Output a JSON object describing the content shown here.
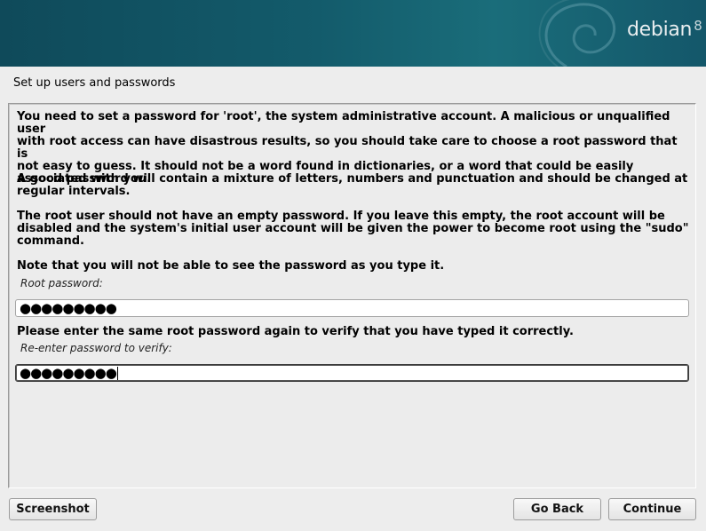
{
  "header": {
    "brand_name": "debian",
    "brand_version": "8"
  },
  "page": {
    "title": "Set up users and passwords",
    "paragraphs": [
      "You need to set a password for 'root', the system administrative account. A malicious or unqualified user\nwith root access can have disastrous results, so you should take care to choose a root password that is\nnot easy to guess. It should not be a word found in dictionaries, or a word that could be easily\nassociated with you.",
      "A good password will contain a mixture of letters, numbers and punctuation and should be changed at\nregular intervals.",
      "The root user should not have an empty password. If you leave this empty, the root account will be\ndisabled and the system's initial user account will be given the power to become root using the \"sudo\"\ncommand.",
      "Note that you will not be able to see the password as you type it."
    ],
    "root_password_label": "Root password:",
    "root_password_value": "●●●●●●●●●",
    "verify_prompt": "Please enter the same root password again to verify that you have typed it correctly.",
    "verify_label": "Re-enter password to verify:",
    "verify_value": "●●●●●●●●●"
  },
  "buttons": {
    "screenshot": "Screenshot",
    "go_back": "Go Back",
    "continue": "Continue"
  },
  "colors": {
    "banner": "#135b6b",
    "background": "#ededed"
  }
}
